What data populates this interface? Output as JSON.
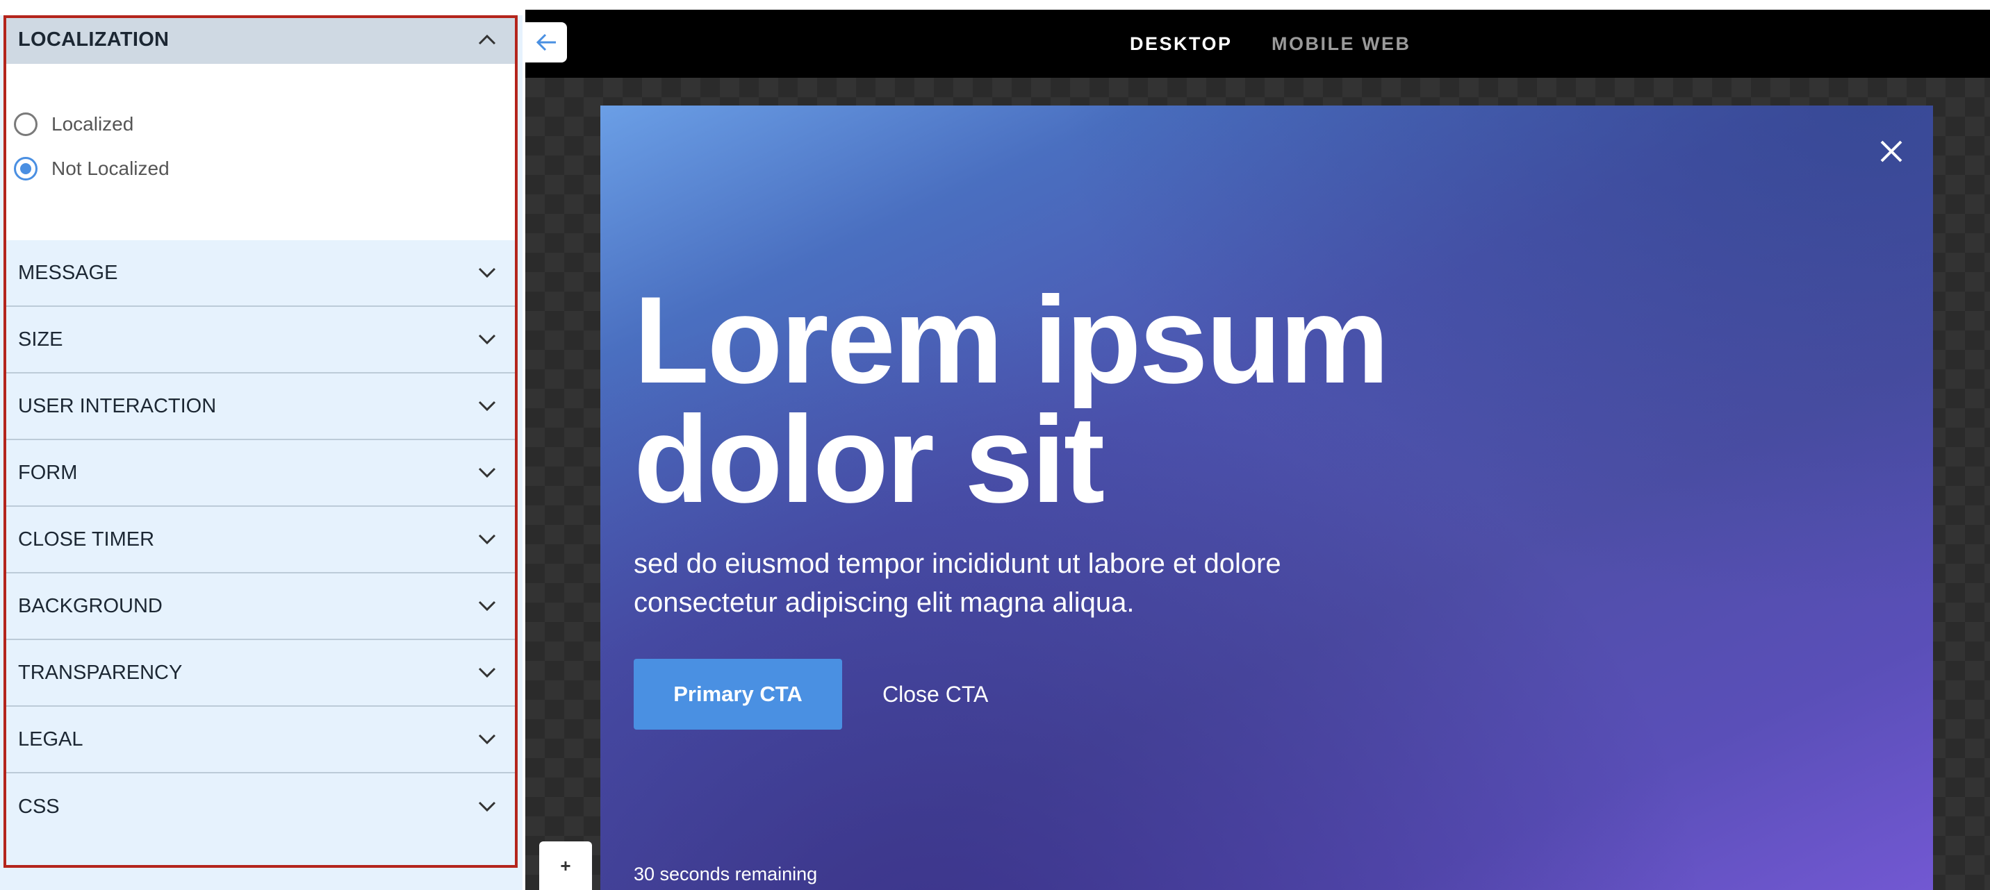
{
  "panel": {
    "open_section": {
      "label": "LOCALIZATION"
    },
    "localization_options": [
      {
        "label": "Localized",
        "checked": false
      },
      {
        "label": "Not Localized",
        "checked": true
      }
    ],
    "sections": [
      {
        "label": "MESSAGE"
      },
      {
        "label": "SIZE"
      },
      {
        "label": "USER INTERACTION"
      },
      {
        "label": "FORM"
      },
      {
        "label": "CLOSE TIMER"
      },
      {
        "label": "BACKGROUND"
      },
      {
        "label": "TRANSPARENCY"
      },
      {
        "label": "LEGAL"
      },
      {
        "label": "CSS"
      }
    ]
  },
  "preview": {
    "tabs": [
      {
        "label": "DESKTOP",
        "active": true
      },
      {
        "label": "MOBILE WEB",
        "active": false
      }
    ],
    "modal": {
      "headline_line1": "Lorem ipsum",
      "headline_line2": "dolor sit",
      "subtext_line1": "sed do eiusmod tempor incididunt ut labore et dolore",
      "subtext_line2": "consectetur adipiscing elit magna aliqua.",
      "primary_cta": "Primary CTA",
      "close_cta": "Close CTA",
      "timer": "30 seconds remaining"
    },
    "add_button": "+"
  },
  "colors": {
    "accent": "#4a90e2",
    "panel_bg": "#e6f2fd",
    "outline": "#b4251c"
  }
}
